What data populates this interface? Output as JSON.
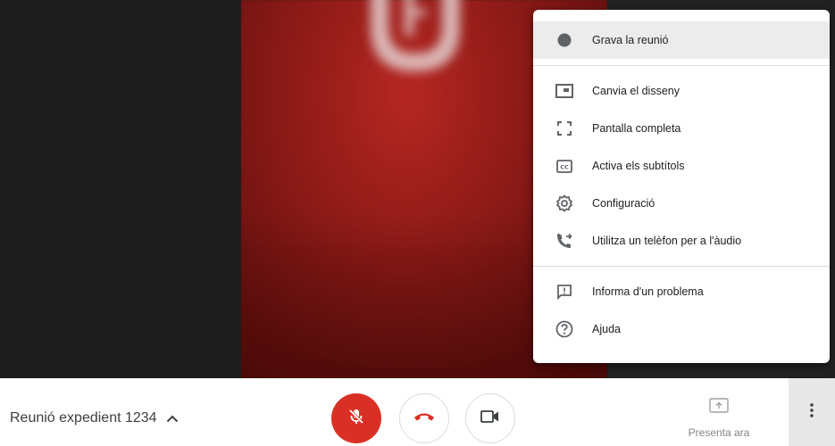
{
  "menu": {
    "items": [
      {
        "label": "Grava la reunió",
        "icon": "record-dot-icon"
      },
      {
        "label": "Canvia el disseny",
        "icon": "layout-icon"
      },
      {
        "label": "Pantalla completa",
        "icon": "fullscreen-icon"
      },
      {
        "label": "Activa els subtítols",
        "icon": "captions-icon"
      },
      {
        "label": "Configuració",
        "icon": "settings-gear-icon"
      },
      {
        "label": "Utilitza un telèfon per a l'àudio",
        "icon": "phone-forward-icon"
      },
      {
        "label": "Informa d'un problema",
        "icon": "feedback-icon"
      },
      {
        "label": "Ajuda",
        "icon": "help-icon"
      }
    ]
  },
  "bottom_bar": {
    "meeting_title": "Reunió expedient 1234",
    "present_label": "Presenta ara"
  },
  "colors": {
    "mic_muted": "#d93025",
    "hangup": "#d93025",
    "menu_highlight": "#ececec"
  }
}
